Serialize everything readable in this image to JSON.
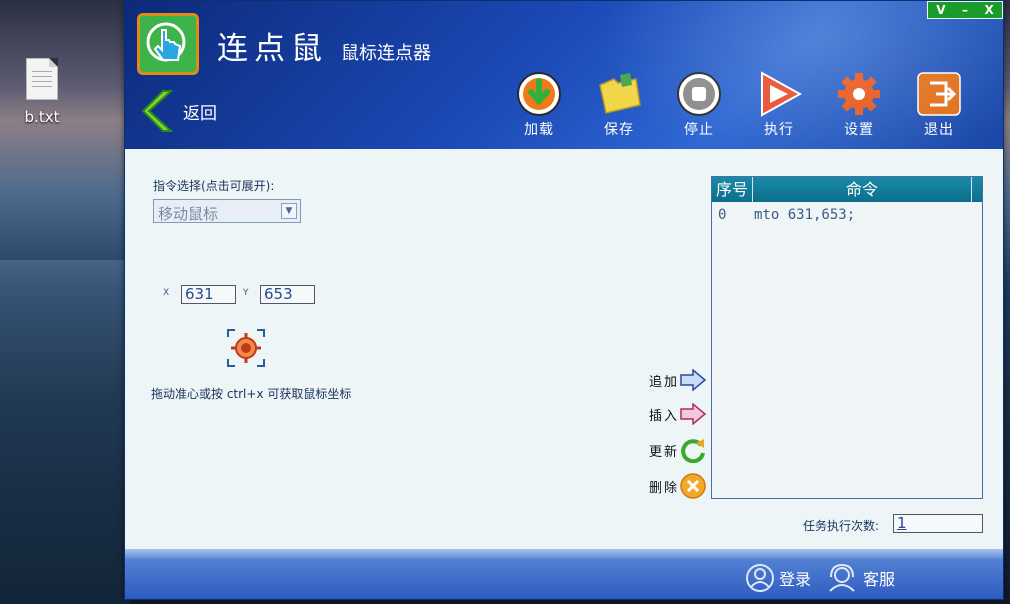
{
  "desktop": {
    "file_label": "b.txt"
  },
  "window": {
    "controls": {
      "minimize_v": "V",
      "minimize": "–",
      "close": "X"
    },
    "title": "连点鼠",
    "subtitle": "鼠标连点器",
    "back_label": "返回"
  },
  "toolbar": {
    "load": "加载",
    "save": "保存",
    "stop": "停止",
    "run": "执行",
    "settings": "设置",
    "exit": "退出"
  },
  "command": {
    "label": "指令选择(点击可展开):",
    "selected": "移动鼠标"
  },
  "coords": {
    "x_label": "X",
    "x_value": "631",
    "y_label": "Y",
    "y_value": "653"
  },
  "hint": "拖动准心或按 ctrl+x 可获取鼠标坐标",
  "actions": {
    "add": "追加",
    "insert": "插入",
    "update": "更新",
    "delete": "删除"
  },
  "list": {
    "headers": {
      "index": "序号",
      "command": "命令"
    },
    "rows": [
      {
        "index": "0",
        "command": "mto 631,653;"
      }
    ]
  },
  "task_count": {
    "label": "任务执行次数:",
    "value": "1"
  },
  "footer": {
    "login": "登录",
    "support": "客服"
  },
  "colors": {
    "header_blue": "#1c49b6",
    "logo_green": "#3db34a",
    "list_header": "#0b6f8c",
    "controls_green": "#1a9c2a"
  }
}
